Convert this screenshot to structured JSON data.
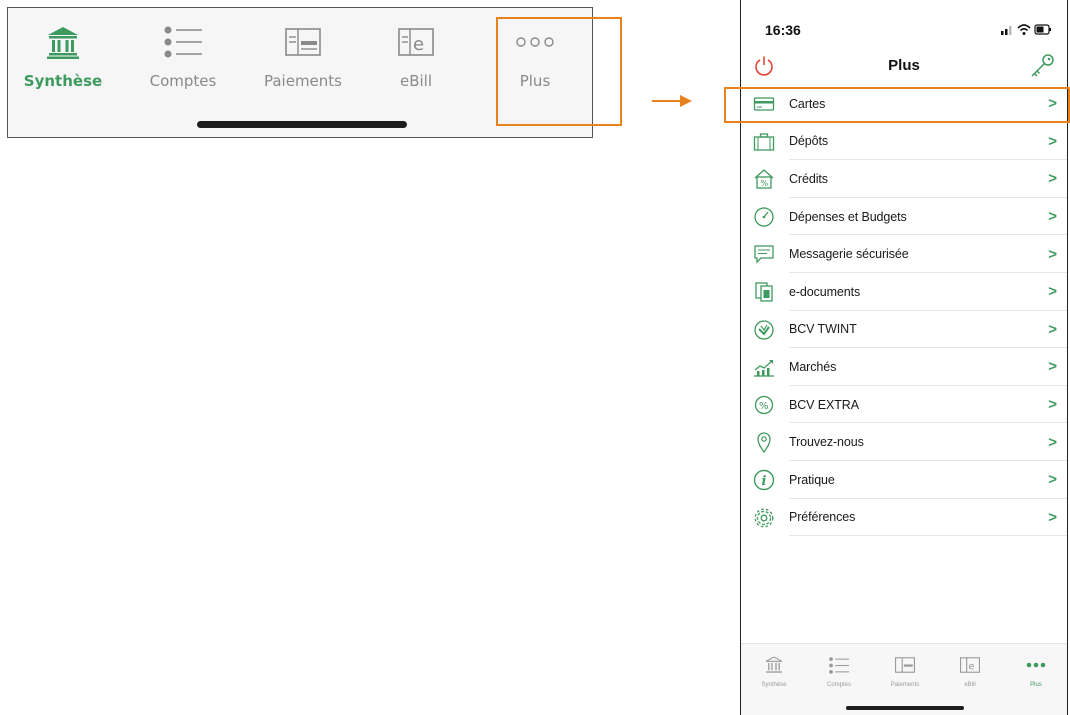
{
  "colors": {
    "accent": "#3f9a5f",
    "highlight": "#e8821c",
    "inactive": "#8a8a8a",
    "power": "#e0483a"
  },
  "zoomed_tab_bar": {
    "tabs": [
      {
        "label": "Synthèse",
        "icon": "bank-icon",
        "active": true
      },
      {
        "label": "Comptes",
        "icon": "list-icon",
        "active": false
      },
      {
        "label": "Paiements",
        "icon": "payment-slip-icon",
        "active": false
      },
      {
        "label": "eBill",
        "icon": "ebill-icon",
        "active": false
      },
      {
        "label": "Plus",
        "icon": "more-dots-icon",
        "active": false
      }
    ]
  },
  "phone": {
    "status_time": "16:36",
    "nav_title": "Plus",
    "menu_items": [
      {
        "label": "Cartes",
        "icon": "card-icon"
      },
      {
        "label": "Dépôts",
        "icon": "briefcase-icon"
      },
      {
        "label": "Crédits",
        "icon": "house-percent-icon"
      },
      {
        "label": "Dépenses et Budgets",
        "icon": "gauge-icon"
      },
      {
        "label": "Messagerie sécurisée",
        "icon": "message-icon"
      },
      {
        "label": "e-documents",
        "icon": "documents-icon"
      },
      {
        "label": "BCV TWINT",
        "icon": "twint-icon"
      },
      {
        "label": "Marchés",
        "icon": "market-chart-icon"
      },
      {
        "label": "BCV EXTRA",
        "icon": "percent-badge-icon"
      },
      {
        "label": "Trouvez-nous",
        "icon": "location-pin-icon"
      },
      {
        "label": "Pratique",
        "icon": "info-icon"
      },
      {
        "label": "Préférences",
        "icon": "gear-icon"
      }
    ],
    "chevron": ">",
    "tab_bar": {
      "tabs": [
        {
          "label": "Synthèse",
          "active": false
        },
        {
          "label": "Comptes",
          "active": false
        },
        {
          "label": "Paiements",
          "active": false
        },
        {
          "label": "eBill",
          "active": false
        },
        {
          "label": "Plus",
          "active": true
        }
      ]
    }
  }
}
